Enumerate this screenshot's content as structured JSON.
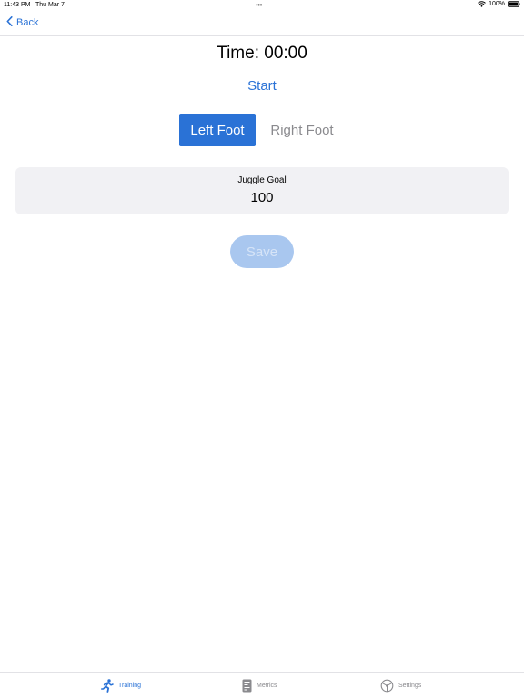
{
  "status_bar": {
    "time": "11:43 PM",
    "date": "Thu Mar 7",
    "dots": "•••",
    "battery": "100%"
  },
  "nav": {
    "back_label": "Back"
  },
  "timer": {
    "label": "Time: 00:00"
  },
  "controls": {
    "start_label": "Start"
  },
  "foot_selector": {
    "options": [
      "Left Foot",
      "Right Foot"
    ],
    "selected": "Left Foot"
  },
  "goal": {
    "label": "Juggle Goal",
    "value": "100"
  },
  "save": {
    "label": "Save",
    "enabled": false
  },
  "tabs": [
    {
      "label": "Training",
      "icon": "running-person-icon",
      "active": true
    },
    {
      "label": "Metrics",
      "icon": "metrics-document-icon",
      "active": false
    },
    {
      "label": "Settings",
      "icon": "gear-icon",
      "active": false
    }
  ],
  "colors": {
    "accent": "#2a72d6",
    "save_disabled": "#a9c7ef",
    "card_background": "#f1f1f4",
    "inactive_text": "#8a8a8e"
  }
}
